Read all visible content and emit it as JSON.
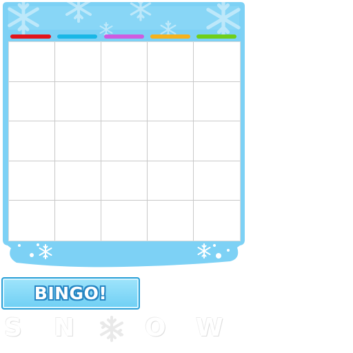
{
  "card": {
    "header_colors": [
      "#e2141b",
      "#19b7e6",
      "#cf5be0",
      "#f5b21d",
      "#6fcf19"
    ],
    "frame_color": "#7dd1f5",
    "frame_light": "#c9eefc",
    "grid": {
      "rows": 5,
      "cols": 5
    }
  },
  "bingo_button": {
    "label": "BINGO!"
  },
  "title_word": {
    "letters": [
      "S",
      "N",
      "O",
      "W"
    ],
    "icon": "snowflake-icon"
  }
}
